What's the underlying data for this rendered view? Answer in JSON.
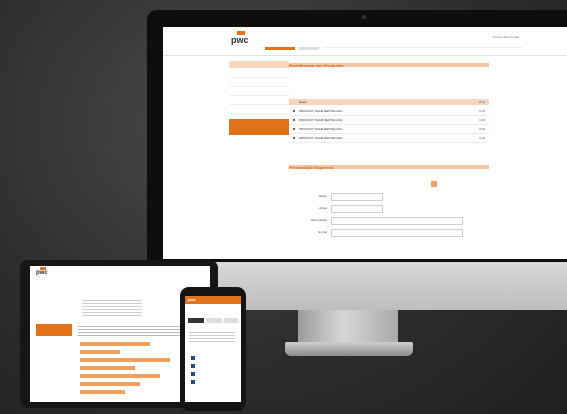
{
  "desktop": {
    "brand": "pwc",
    "header_right": "Eerste Hulp Portaal",
    "section_title": "Bestelbewaar van Producten",
    "table_head_left": "Naam",
    "table_head_right": "Prijs",
    "rows": [
      {
        "label": "PRODUCT NAAM BESTELLING",
        "value": "0,00"
      },
      {
        "label": "PRODUCT NAAM BESTELLING",
        "value": "0,00"
      },
      {
        "label": "PRODUCT NAAM BESTELLING",
        "value": "0,00"
      },
      {
        "label": "PRODUCT NAAM BESTELLING",
        "value": "0,00"
      }
    ],
    "form_title": "Persoonlijke Gegevens",
    "fields": [
      {
        "label": "Naam"
      },
      {
        "label": "Adres"
      },
      {
        "label": "Woonplaats"
      },
      {
        "label": "E-mail"
      }
    ]
  },
  "tablet": {
    "brand": "pwc"
  },
  "phone": {
    "brand": "pwc"
  },
  "colors": {
    "accent": "#e0721c",
    "accent_light": "#f6d6bd",
    "bezel": "#0e0e0e"
  }
}
